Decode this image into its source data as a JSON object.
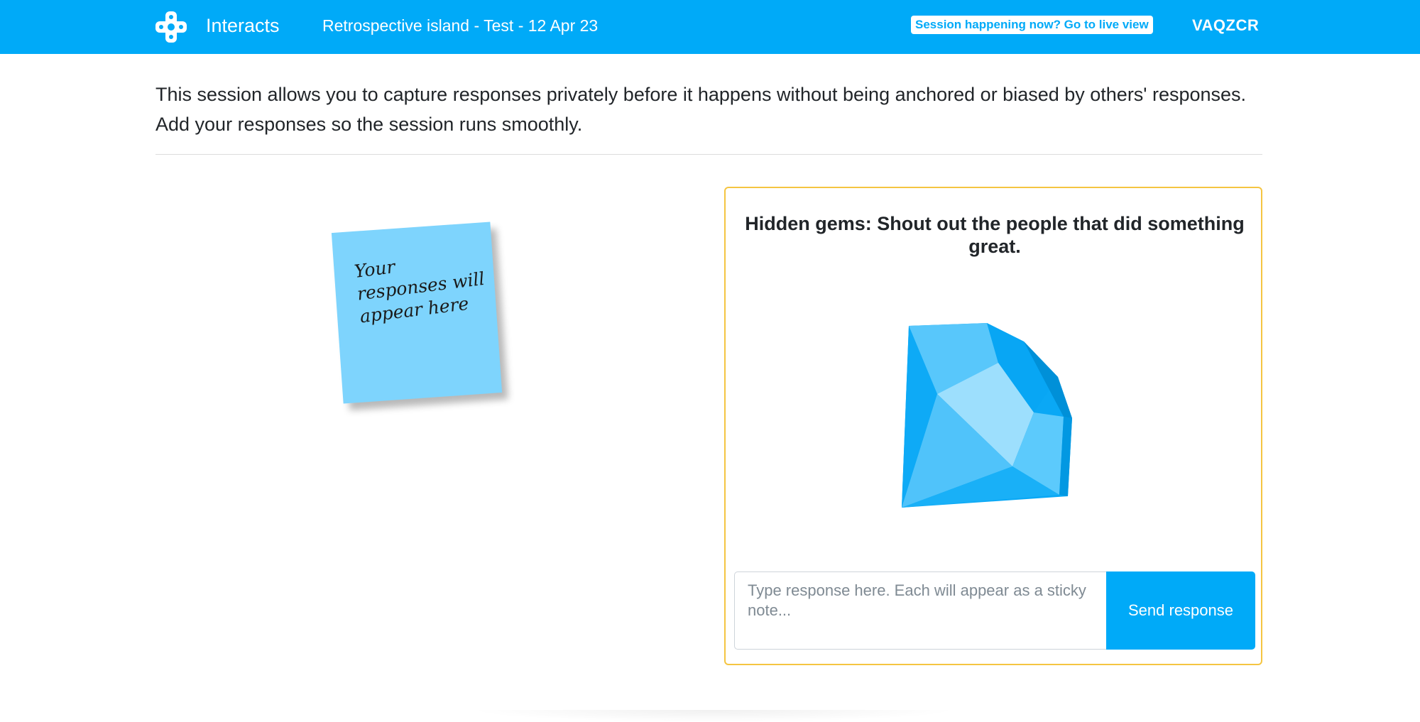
{
  "header": {
    "brand_name": "Interacts",
    "session_title": "Retrospective island - Test - 12 Apr 23",
    "live_link": "Session happening now? Go to live view",
    "session_code": "VAQZCR",
    "background_color": "#00aaf8"
  },
  "intro": {
    "line1": "This session allows you to capture responses privately before it happens without being anchored or biased by others' responses.",
    "line2": "Add your responses so the session runs smoothly."
  },
  "sticky_note": {
    "text": "Your responses will appear here",
    "color": "#7ed4fd"
  },
  "question_card": {
    "title": "Hidden gems: Shout out the people that did something great.",
    "icon": "diamond-icon",
    "border_color": "#f5c542",
    "input_placeholder": "Type response here. Each will appear as a sticky note...",
    "input_value": "",
    "send_label": "Send response"
  }
}
